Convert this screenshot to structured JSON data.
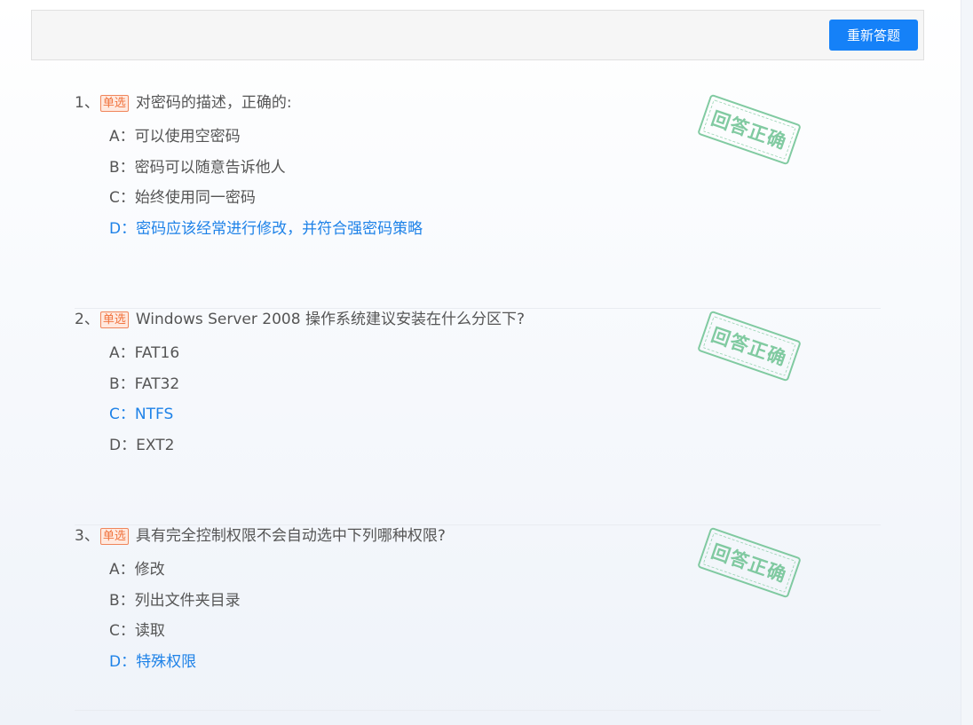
{
  "toolbar": {
    "redo_label": "重新答题"
  },
  "questions": [
    {
      "number": "1、",
      "type": "单选",
      "text": "对密码的描述，正确的:",
      "stamp": "回答正确",
      "options": [
        {
          "label": "A：",
          "text": "可以使用空密码",
          "correct": false
        },
        {
          "label": "B：",
          "text": "密码可以随意告诉他人",
          "correct": false
        },
        {
          "label": "C：",
          "text": "始终使用同一密码",
          "correct": false
        },
        {
          "label": "D：",
          "text": "密码应该经常进行修改，并符合强密码策略",
          "correct": true
        }
      ]
    },
    {
      "number": "2、",
      "type": "单选",
      "text": "Windows Server 2008 操作系统建议安装在什么分区下?",
      "stamp": "回答正确",
      "options": [
        {
          "label": "A：",
          "text": "FAT16",
          "correct": false
        },
        {
          "label": "B：",
          "text": "FAT32",
          "correct": false
        },
        {
          "label": "C：",
          "text": "NTFS",
          "correct": true
        },
        {
          "label": "D：",
          "text": "EXT2",
          "correct": false
        }
      ]
    },
    {
      "number": "3、",
      "type": "单选",
      "text": "具有完全控制权限不会自动选中下列哪种权限?",
      "stamp": "回答正确",
      "options": [
        {
          "label": "A：",
          "text": "修改",
          "correct": false
        },
        {
          "label": "B：",
          "text": "列出文件夹目录",
          "correct": false
        },
        {
          "label": "C：",
          "text": "读取",
          "correct": false
        },
        {
          "label": "D：",
          "text": "特殊权限",
          "correct": true
        }
      ]
    }
  ],
  "colors": {
    "accent": "#1581f8",
    "correct_option": "#1e82e8",
    "stamp": "#6cc291",
    "type_badge": "#f0733d"
  }
}
